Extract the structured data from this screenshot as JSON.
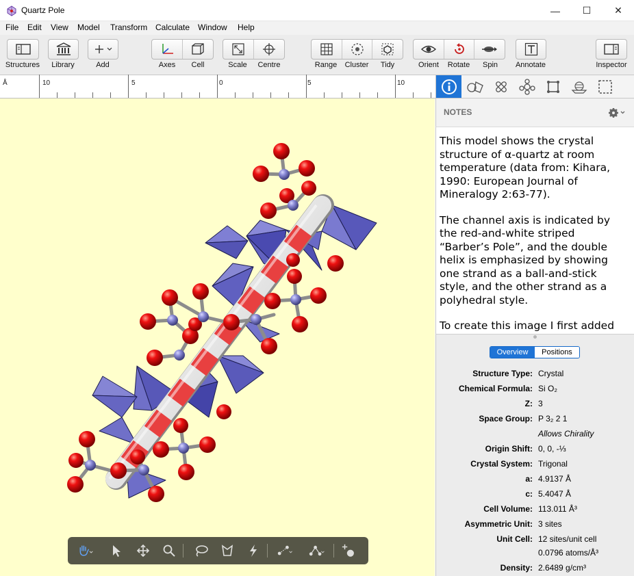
{
  "window": {
    "title": "Quartz Pole",
    "minimize": "—",
    "maximize": "☐",
    "close": "✕"
  },
  "menu": [
    "File",
    "Edit",
    "View",
    "Model",
    "Transform",
    "Calculate",
    "Window",
    "Help"
  ],
  "toolbar": {
    "structures": "Structures",
    "library": "Library",
    "add": "Add",
    "axes": "Axes",
    "cell": "Cell",
    "scale": "Scale",
    "centre": "Centre",
    "range": "Range",
    "cluster": "Cluster",
    "tidy": "Tidy",
    "orient": "Orient",
    "rotate": "Rotate",
    "spin": "Spin",
    "annotate": "Annotate",
    "inspector": "Inspector"
  },
  "ruler": {
    "unit": "Å",
    "labels": [
      "10",
      "5",
      "0",
      "5",
      "10"
    ]
  },
  "notes": {
    "header": "NOTES",
    "paragraphs": [
      "This model shows the crystal structure of α-quartz at room temperature (data from: Kihara, 1990: European Journal of Mineralogy 2:63-77).",
      "The channel axis is indicated by the red-and-white striped “Barber’s Pole”, and the double helix is emphasized by showing one strand as a ball-and-stick style, and the other strand as a polyhedral style.",
      "To create this image I first added"
    ]
  },
  "overview": {
    "tabs": [
      "Overview",
      "Positions"
    ],
    "properties": [
      {
        "key": "Structure Type:",
        "value": "Crystal"
      },
      {
        "key": "Chemical Formula:",
        "value": "Si O₂"
      },
      {
        "key": "Z:",
        "value": "3"
      },
      {
        "key": "Space Group:",
        "value": "P 3₂ 2 1"
      },
      {
        "key": "",
        "value": "Allows Chirality"
      },
      {
        "key": "Origin Shift:",
        "value": "0, 0, -⅓"
      },
      {
        "key": "Crystal System:",
        "value": "Trigonal"
      },
      {
        "key": "a:",
        "value": "4.9137 Å"
      },
      {
        "key": "c:",
        "value": "5.4047 Å"
      },
      {
        "key": "Cell Volume:",
        "value": "113.011 Å³"
      },
      {
        "key": "Asymmetric Unit:",
        "value": "3 sites"
      },
      {
        "key": "Unit Cell:",
        "value": "12 sites/unit cell"
      },
      {
        "key": "",
        "value": "0.0796 atoms/Å³"
      },
      {
        "key": "Density:",
        "value": "2.6489 g/cm³"
      }
    ]
  },
  "colors": {
    "viewport_bg": "#ffffcc",
    "accent": "#1f74d6",
    "oxygen": "#dd0000",
    "silicon": "#8080cc",
    "polyhedra": "#6f6fc8"
  },
  "icons": [
    "hand-icon",
    "arrow-icon",
    "move-icon",
    "magnifier-icon",
    "lasso-icon",
    "polygon-select-icon",
    "lightning-icon",
    "bond-icon",
    "angle-icon",
    "add-atom-icon"
  ]
}
